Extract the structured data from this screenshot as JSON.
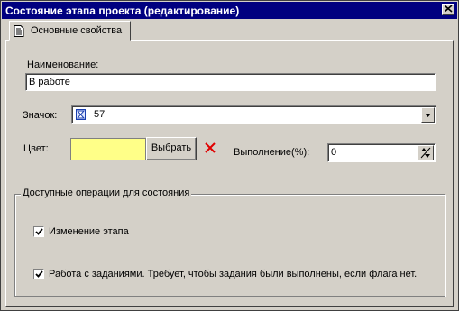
{
  "window": {
    "title": "Состояние этапа проекта (редактирование)"
  },
  "tabs": [
    {
      "label": "Основные свойства",
      "icon": "document-icon"
    }
  ],
  "form": {
    "name_label": "Наименование:",
    "name_value": "В работе",
    "icon_label": "Значок:",
    "icon_value": "57",
    "icon_value_icon": "hourglass-icon",
    "color_label": "Цвет:",
    "color_value": "#ffff88",
    "choose_button": "Выбрать",
    "progress_label": "Выполнение(%):",
    "progress_value": "0"
  },
  "operations": {
    "title": "Доступные операции для состояния",
    "items": [
      {
        "label": "Изменение этапа",
        "checked": true
      },
      {
        "label": "Работа с заданиями. Требует, чтобы задания были выполнены, если флага нет.",
        "checked": true
      }
    ]
  },
  "colors": {
    "titlebar": "#000080",
    "face": "#d4d0c8",
    "clear_x": "#e00000"
  }
}
